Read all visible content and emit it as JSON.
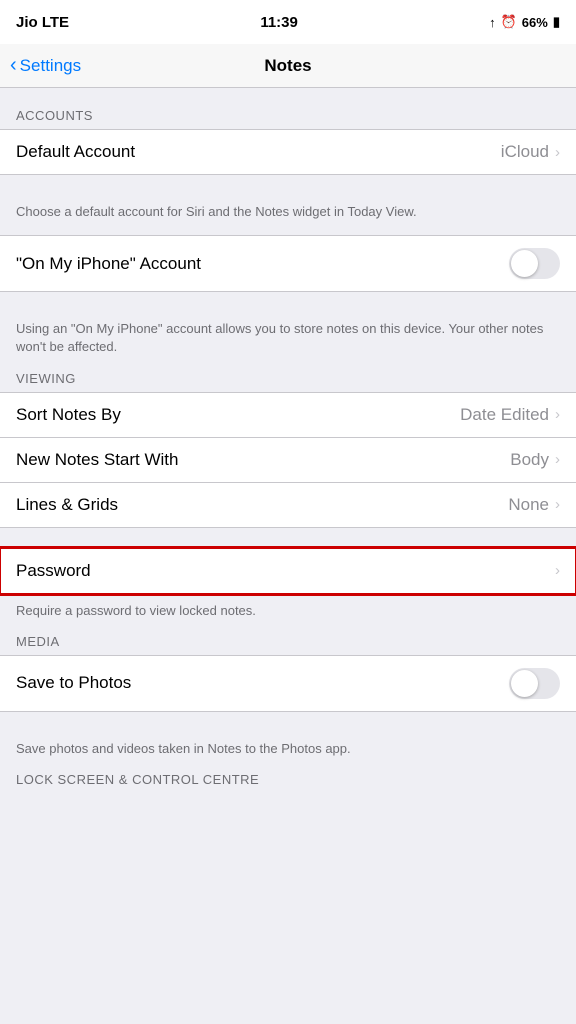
{
  "statusBar": {
    "carrier": "Jio  LTE",
    "time": "11:39",
    "battery": "66%"
  },
  "navBar": {
    "backLabel": "Settings",
    "title": "Notes"
  },
  "sections": {
    "accounts": {
      "header": "ACCOUNTS",
      "rows": [
        {
          "id": "default-account",
          "label": "Default Account",
          "value": "iCloud",
          "hasChevron": true,
          "hasToggle": false
        }
      ],
      "description": "Choose a default account for Siri and the Notes widget in Today View."
    },
    "onMyPhone": {
      "rows": [
        {
          "id": "on-my-iphone",
          "label": "\"On My iPhone\" Account",
          "value": "",
          "hasChevron": false,
          "hasToggle": true,
          "toggleOn": false
        }
      ],
      "description": "Using an \"On My iPhone\" account allows you to store notes on this device. Your other notes won't be affected."
    },
    "viewing": {
      "header": "VIEWING",
      "rows": [
        {
          "id": "sort-notes-by",
          "label": "Sort Notes By",
          "value": "Date Edited",
          "hasChevron": true,
          "hasToggle": false
        },
        {
          "id": "new-notes-start-with",
          "label": "New Notes Start With",
          "value": "Body",
          "hasChevron": true,
          "hasToggle": false
        },
        {
          "id": "lines-grids",
          "label": "Lines & Grids",
          "value": "None",
          "hasChevron": true,
          "hasToggle": false
        }
      ]
    },
    "password": {
      "rows": [
        {
          "id": "password",
          "label": "Password",
          "value": "",
          "hasChevron": true,
          "hasToggle": false,
          "highlighted": true
        }
      ],
      "description": "Require a password to view locked notes."
    },
    "media": {
      "header": "MEDIA",
      "rows": [
        {
          "id": "save-to-photos",
          "label": "Save to Photos",
          "value": "",
          "hasChevron": false,
          "hasToggle": true,
          "toggleOn": false
        }
      ],
      "description": "Save photos and videos taken in Notes to the Photos app."
    },
    "lockScreen": {
      "header": "LOCK SCREEN & CONTROL CENTRE"
    }
  },
  "icons": {
    "chevron": "›",
    "backChevron": "‹"
  }
}
